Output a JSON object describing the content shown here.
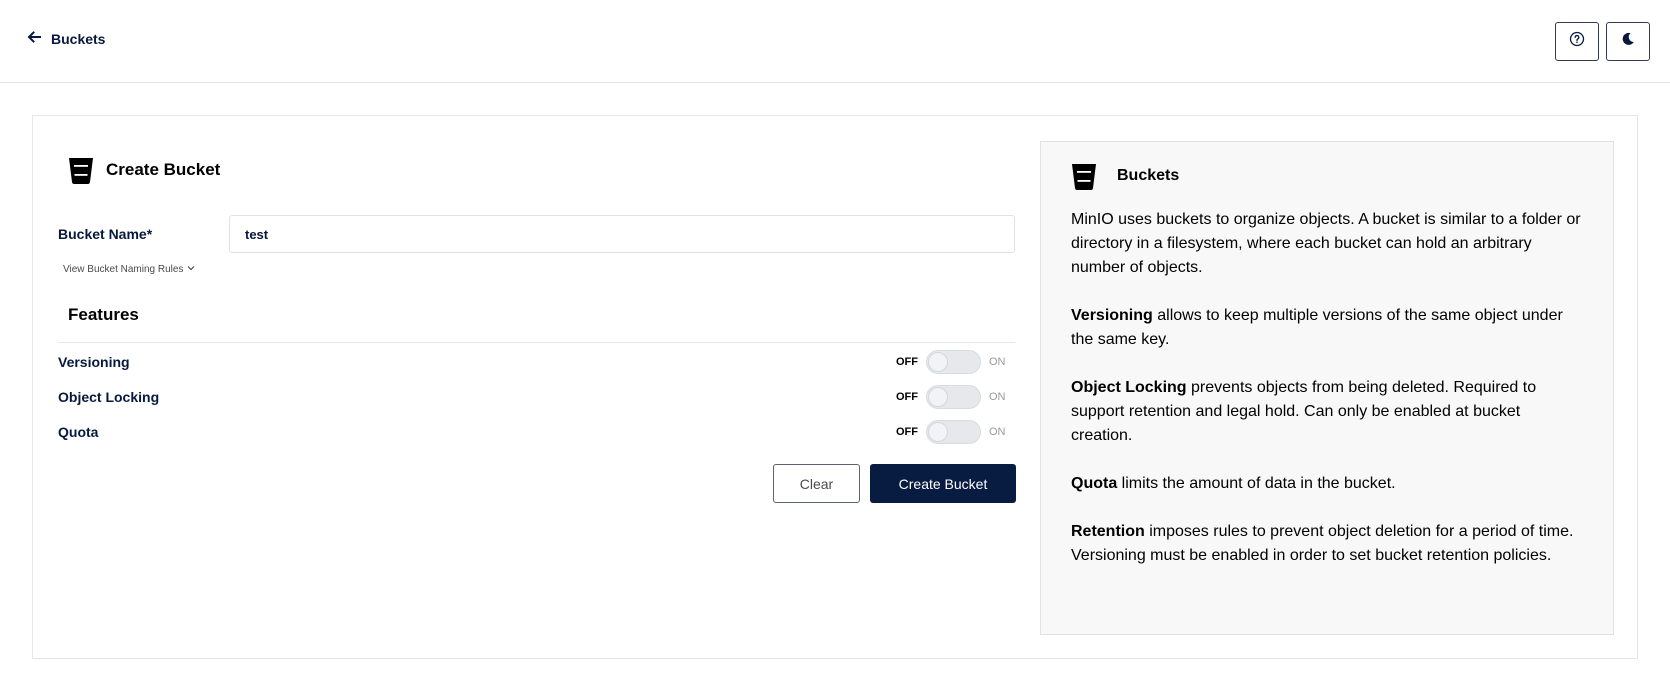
{
  "topbar": {
    "back_label": "Buckets",
    "help_icon": "help-circle-icon",
    "theme_icon": "moon-icon"
  },
  "form": {
    "title": "Create Bucket",
    "bucket_name_label": "Bucket Name*",
    "bucket_name_value": "test",
    "naming_rules_label": "View Bucket Naming Rules",
    "features_title": "Features",
    "features": [
      {
        "label": "Versioning",
        "off": "OFF",
        "on": "ON",
        "enabled": false
      },
      {
        "label": "Object Locking",
        "off": "OFF",
        "on": "ON",
        "enabled": false
      },
      {
        "label": "Quota",
        "off": "OFF",
        "on": "ON",
        "enabled": false
      }
    ],
    "clear_label": "Clear",
    "create_label": "Create Bucket"
  },
  "help": {
    "title": "Buckets",
    "intro": "MinIO uses buckets to organize objects. A bucket is similar to a folder or directory in a filesystem, where each bucket can hold an arbitrary number of objects.",
    "versioning_term": "Versioning",
    "versioning_text": " allows to keep multiple versions of the same object under the same key.",
    "locking_term": "Object Locking",
    "locking_text": " prevents objects from being deleted. Required to support retention and legal hold. Can only be enabled at bucket creation.",
    "quota_term": "Quota",
    "quota_text": " limits the amount of data in the bucket.",
    "retention_term": "Retention",
    "retention_text": " imposes rules to prevent object deletion for a period of time. Versioning must be enabled in order to set bucket retention policies."
  },
  "colors": {
    "primary": "#081c42",
    "text": "#07193e",
    "panel_bg": "#f8f8f8"
  }
}
